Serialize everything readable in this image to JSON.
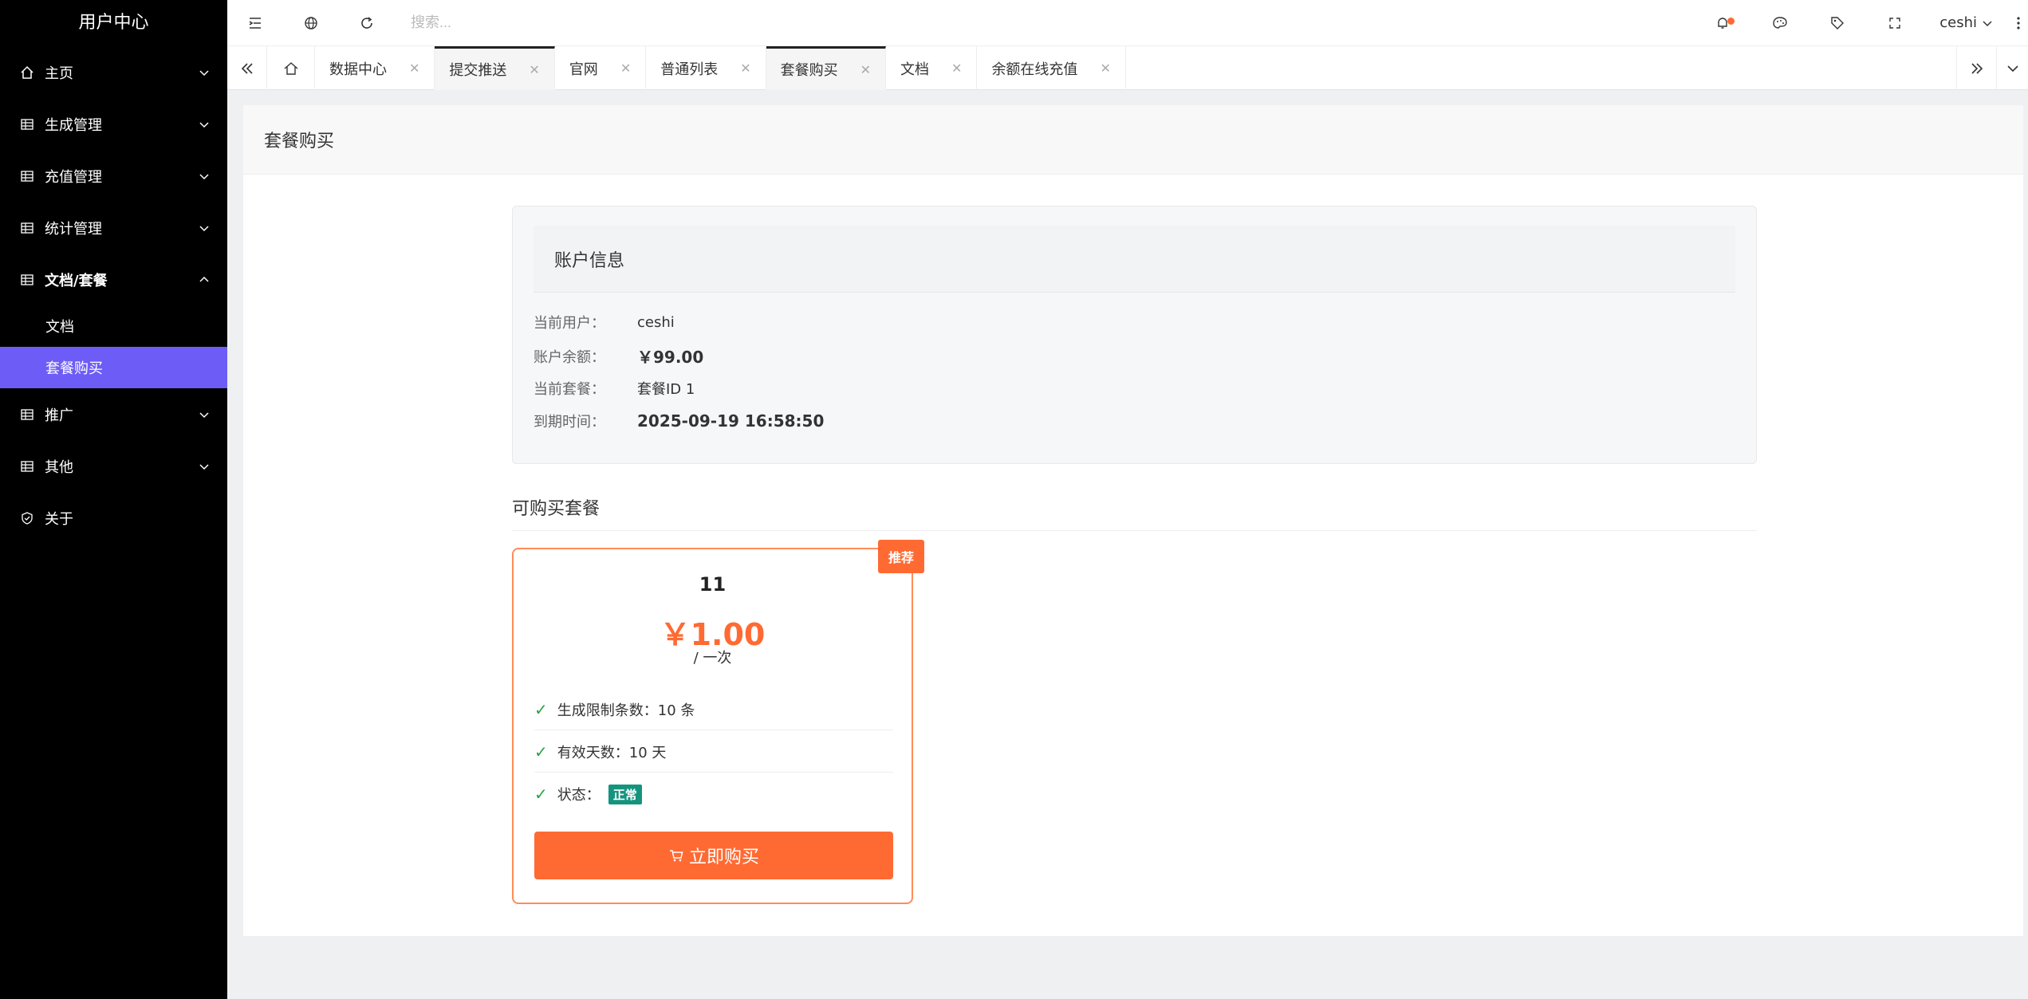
{
  "app": {
    "title": "用户中心"
  },
  "sidebar": {
    "items": [
      {
        "label": "主页",
        "icon": "home-icon"
      },
      {
        "label": "生成管理",
        "icon": "grid-icon"
      },
      {
        "label": "充值管理",
        "icon": "grid-icon"
      },
      {
        "label": "统计管理",
        "icon": "grid-icon"
      },
      {
        "label": "文档/套餐",
        "icon": "grid-icon",
        "expanded": true,
        "children": [
          {
            "label": "文档"
          },
          {
            "label": "套餐购买",
            "active": true
          }
        ]
      },
      {
        "label": "推广",
        "icon": "grid-icon"
      },
      {
        "label": "其他",
        "icon": "grid-icon"
      },
      {
        "label": "关于",
        "icon": "shield-check-icon"
      }
    ]
  },
  "header": {
    "search_placeholder": "搜索...",
    "username": "ceshi",
    "notification_dot_color": "#ff6a33"
  },
  "tabs": [
    {
      "label": "数据中心"
    },
    {
      "label": "提交推送",
      "active": true
    },
    {
      "label": "官网"
    },
    {
      "label": "普通列表"
    },
    {
      "label": "套餐购买",
      "active": true
    },
    {
      "label": "文档"
    },
    {
      "label": "余额在线充值"
    }
  ],
  "page": {
    "title": "套餐购买",
    "account": {
      "title": "账户信息",
      "user_label": "当前用户：",
      "user_value": "ceshi",
      "balance_label": "账户余额：",
      "balance_value": "￥99.00",
      "package_label": "当前套餐：",
      "package_value": "套餐ID 1",
      "expire_label": "到期时间：",
      "expire_value": "2025-09-19 16:58:50"
    },
    "available_title": "可购买套餐",
    "package": {
      "badge": "推荐",
      "name": "11",
      "price": "￥1.00",
      "unit": "/ 一次",
      "feature_limit": "生成限制条数：10 条",
      "feature_days": "有效天数：10 天",
      "status_label": "状态：",
      "status_value": "正常",
      "buy_label": "立即购买"
    }
  },
  "colors": {
    "accent": "#6d5cf6",
    "orange": "#ff6a33",
    "green": "#2aa245",
    "teal": "#14947e"
  }
}
